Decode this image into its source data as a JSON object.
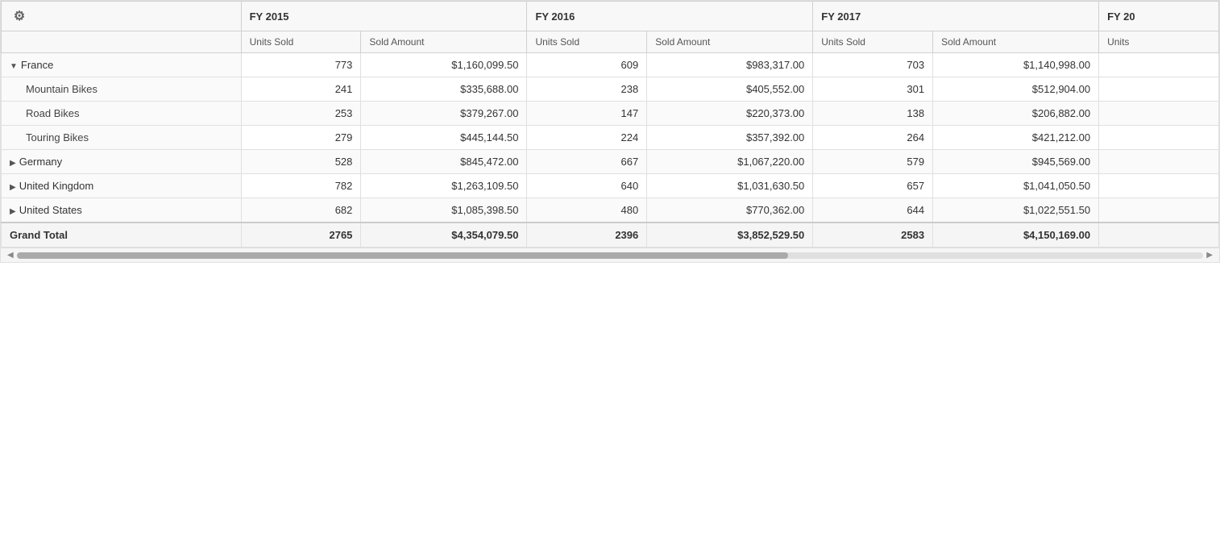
{
  "gear_icon": "⚙",
  "scroll_arrow_left": "◀",
  "scroll_arrow_right": "▶",
  "years": [
    {
      "label": "FY 2015",
      "colspan": 2
    },
    {
      "label": "FY 2016",
      "colspan": 2
    },
    {
      "label": "FY 2017",
      "colspan": 2
    },
    {
      "label": "FY 20…",
      "colspan": 1
    }
  ],
  "col_headers": [
    "Units Sold",
    "Sold Amount",
    "Units Sold",
    "Sold Amount",
    "Units Sold",
    "Sold Amount",
    "Units"
  ],
  "rows": [
    {
      "type": "country",
      "expanded": true,
      "label": "France",
      "fy2015_units": "773",
      "fy2015_amount": "$1,160,099.50",
      "fy2016_units": "609",
      "fy2016_amount": "$983,317.00",
      "fy2017_units": "703",
      "fy2017_amount": "$1,140,998.00"
    },
    {
      "type": "subcategory",
      "label": "Mountain Bikes",
      "fy2015_units": "241",
      "fy2015_amount": "$335,688.00",
      "fy2016_units": "238",
      "fy2016_amount": "$405,552.00",
      "fy2017_units": "301",
      "fy2017_amount": "$512,904.00"
    },
    {
      "type": "subcategory",
      "label": "Road Bikes",
      "fy2015_units": "253",
      "fy2015_amount": "$379,267.00",
      "fy2016_units": "147",
      "fy2016_amount": "$220,373.00",
      "fy2017_units": "138",
      "fy2017_amount": "$206,882.00"
    },
    {
      "type": "subcategory",
      "label": "Touring Bikes",
      "fy2015_units": "279",
      "fy2015_amount": "$445,144.50",
      "fy2016_units": "224",
      "fy2016_amount": "$357,392.00",
      "fy2017_units": "264",
      "fy2017_amount": "$421,212.00"
    },
    {
      "type": "country",
      "expanded": false,
      "label": "Germany",
      "fy2015_units": "528",
      "fy2015_amount": "$845,472.00",
      "fy2016_units": "667",
      "fy2016_amount": "$1,067,220.00",
      "fy2017_units": "579",
      "fy2017_amount": "$945,569.00"
    },
    {
      "type": "country",
      "expanded": false,
      "label": "United Kingdom",
      "fy2015_units": "782",
      "fy2015_amount": "$1,263,109.50",
      "fy2016_units": "640",
      "fy2016_amount": "$1,031,630.50",
      "fy2017_units": "657",
      "fy2017_amount": "$1,041,050.50"
    },
    {
      "type": "country",
      "expanded": false,
      "label": "United States",
      "fy2015_units": "682",
      "fy2015_amount": "$1,085,398.50",
      "fy2016_units": "480",
      "fy2016_amount": "$770,362.00",
      "fy2017_units": "644",
      "fy2017_amount": "$1,022,551.50"
    },
    {
      "type": "grand-total",
      "label": "Grand Total",
      "fy2015_units": "2765",
      "fy2015_amount": "$4,354,079.50",
      "fy2016_units": "2396",
      "fy2016_amount": "$3,852,529.50",
      "fy2017_units": "2583",
      "fy2017_amount": "$4,150,169.00"
    }
  ]
}
